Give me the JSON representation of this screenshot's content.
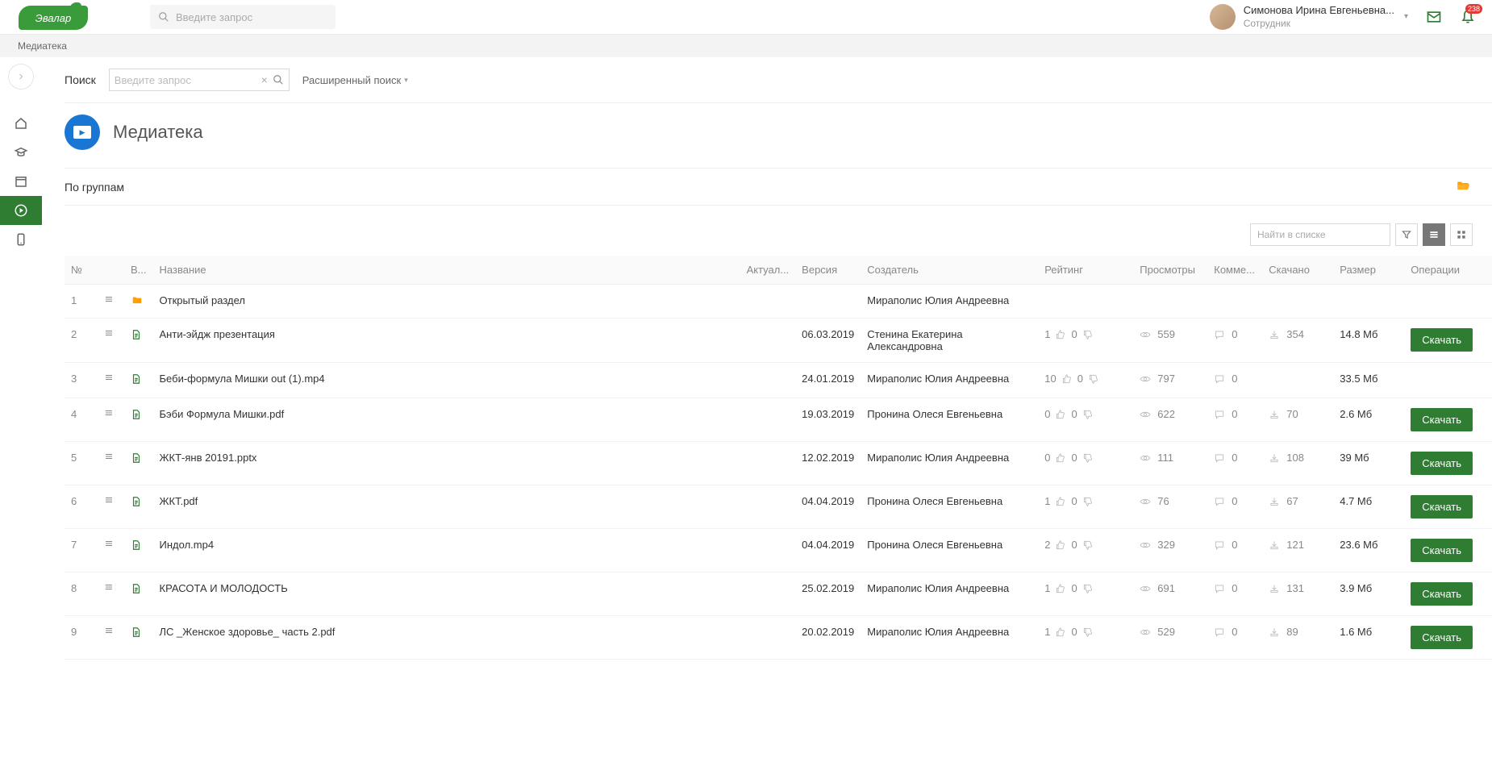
{
  "header": {
    "logo_text": "Эвалар",
    "search_placeholder": "Введите запрос",
    "user_name": "Симонова Ирина Евгеньевна...",
    "user_role": "Сотрудник",
    "notification_count": "238"
  },
  "breadcrumb": "Медиатека",
  "search": {
    "label": "Поиск",
    "placeholder": "Введите запрос",
    "advanced": "Расширенный поиск"
  },
  "page": {
    "title": "Медиатека",
    "group_label": "По группам"
  },
  "toolbar": {
    "list_search_placeholder": "Найти в списке"
  },
  "table": {
    "headers": {
      "num": "№",
      "type": "В...",
      "name": "Название",
      "aktual": "Актуал...",
      "version": "Версия",
      "creator": "Создатель",
      "rating": "Рейтинг",
      "views": "Просмотры",
      "comments": "Комме...",
      "downloads": "Скачано",
      "size": "Размер",
      "ops": "Операции"
    },
    "download_label": "Скачать",
    "rows": [
      {
        "num": "1",
        "type": "folder",
        "name": "Открытый раздел",
        "version": "",
        "creator": "Мираполис Юлия Андреевна",
        "likes": "",
        "dislikes": "",
        "views": "",
        "comments": "",
        "downloads": "",
        "size": "",
        "downloadable": false
      },
      {
        "num": "2",
        "type": "file",
        "name": "Анти-эйдж презентация",
        "version": "06.03.2019",
        "creator": "Стенина Екатерина Александровна",
        "likes": "1",
        "dislikes": "0",
        "views": "559",
        "comments": "0",
        "downloads": "354",
        "size": "14.8 Мб",
        "downloadable": true
      },
      {
        "num": "3",
        "type": "file",
        "name": "Беби-формула Мишки out (1).mp4",
        "version": "24.01.2019",
        "creator": "Мираполис Юлия Андреевна",
        "likes": "10",
        "dislikes": "0",
        "views": "797",
        "comments": "0",
        "downloads": "",
        "size": "33.5 Мб",
        "downloadable": false
      },
      {
        "num": "4",
        "type": "file",
        "name": "Бэби Формула Мишки.pdf",
        "version": "19.03.2019",
        "creator": "Пронина Олеся Евгеньевна",
        "likes": "0",
        "dislikes": "0",
        "views": "622",
        "comments": "0",
        "downloads": "70",
        "size": "2.6 Мб",
        "downloadable": true
      },
      {
        "num": "5",
        "type": "file",
        "name": "ЖКТ-янв 20191.pptx",
        "version": "12.02.2019",
        "creator": "Мираполис Юлия Андреевна",
        "likes": "0",
        "dislikes": "0",
        "views": "111",
        "comments": "0",
        "downloads": "108",
        "size": "39 Мб",
        "downloadable": true
      },
      {
        "num": "6",
        "type": "file",
        "name": "ЖКТ.pdf",
        "version": "04.04.2019",
        "creator": "Пронина Олеся Евгеньевна",
        "likes": "1",
        "dislikes": "0",
        "views": "76",
        "comments": "0",
        "downloads": "67",
        "size": "4.7 Мб",
        "downloadable": true
      },
      {
        "num": "7",
        "type": "file",
        "name": "Индол.mp4",
        "version": "04.04.2019",
        "creator": "Пронина Олеся Евгеньевна",
        "likes": "2",
        "dislikes": "0",
        "views": "329",
        "comments": "0",
        "downloads": "121",
        "size": "23.6 Мб",
        "downloadable": true
      },
      {
        "num": "8",
        "type": "file",
        "name": "КРАСОТА И МОЛОДОСТЬ",
        "version": "25.02.2019",
        "creator": "Мираполис Юлия Андреевна",
        "likes": "1",
        "dislikes": "0",
        "views": "691",
        "comments": "0",
        "downloads": "131",
        "size": "3.9 Мб",
        "downloadable": true
      },
      {
        "num": "9",
        "type": "file",
        "name": "ЛС _Женское здоровье_ часть 2.pdf",
        "version": "20.02.2019",
        "creator": "Мираполис Юлия Андреевна",
        "likes": "1",
        "dislikes": "0",
        "views": "529",
        "comments": "0",
        "downloads": "89",
        "size": "1.6 Мб",
        "downloadable": true
      }
    ]
  }
}
